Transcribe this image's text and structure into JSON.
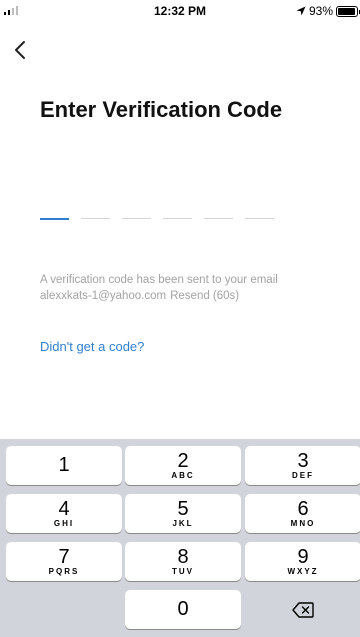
{
  "status_bar": {
    "time": "12:32 PM",
    "battery_text": "93%",
    "battery_level": 0.93,
    "signal_bars_active": 2,
    "icons": [
      "signal-icon",
      "location-arrow-icon",
      "battery-icon"
    ]
  },
  "nav": {
    "back_icon": "chevron-left-icon"
  },
  "title": "Enter Verification Code",
  "code_input": {
    "length": 6,
    "filled": 0,
    "active_index": 0
  },
  "info": {
    "line1": "A verification code has been sent to your email",
    "email": "alexxkats-1@yahoo.com",
    "resend": "Resend (60s)"
  },
  "help_link": "Didn't get a code?",
  "keypad": {
    "keys": [
      {
        "digit": "1",
        "letters": ""
      },
      {
        "digit": "2",
        "letters": "ABC"
      },
      {
        "digit": "3",
        "letters": "DEF"
      },
      {
        "digit": "4",
        "letters": "GHI"
      },
      {
        "digit": "5",
        "letters": "JKL"
      },
      {
        "digit": "6",
        "letters": "MNO"
      },
      {
        "digit": "7",
        "letters": "PQRS"
      },
      {
        "digit": "8",
        "letters": "TUV"
      },
      {
        "digit": "9",
        "letters": "WXYZ"
      },
      {
        "digit": "0",
        "letters": ""
      }
    ],
    "delete_icon": "backspace-icon"
  },
  "colors": {
    "accent": "#2f7fd1",
    "muted_text": "#a3a3a3",
    "keyboard_bg": "#d1d4da"
  }
}
